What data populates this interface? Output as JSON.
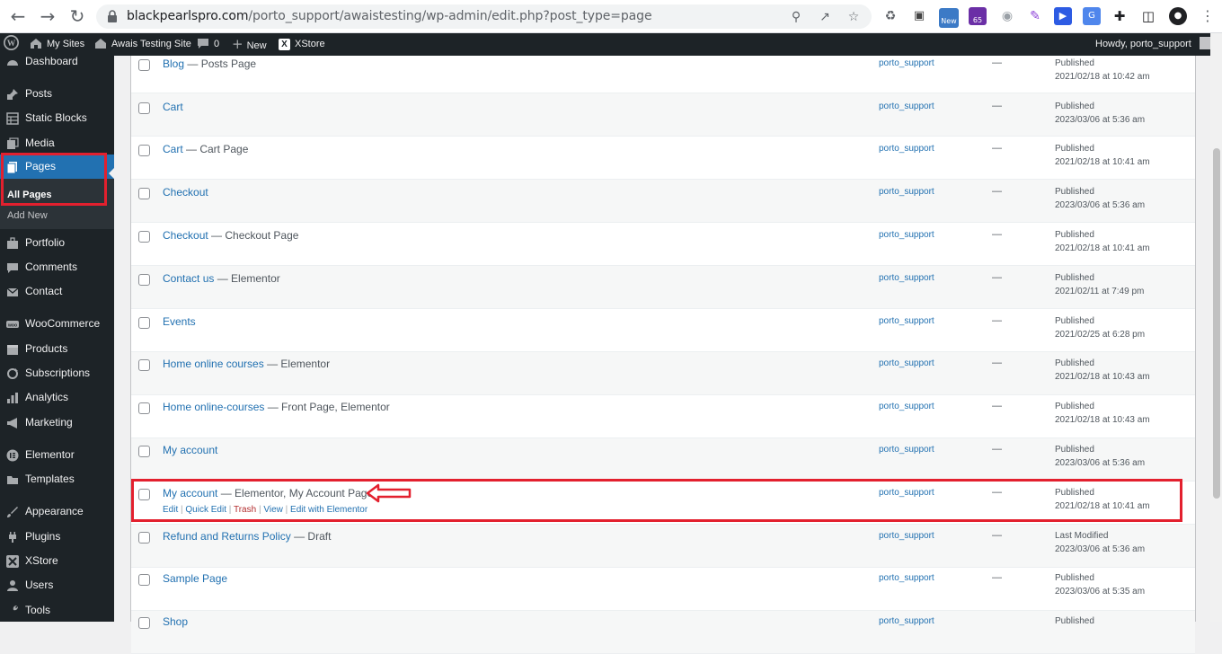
{
  "browser": {
    "url_host": "blackpearlspro.com",
    "url_path": "/porto_support/awaistesting/wp-admin/edit.php?post_type=page",
    "ext_badge_new": "New",
    "ext_badge_count": "65"
  },
  "adminbar": {
    "my_sites": "My Sites",
    "site_name": "Awais Testing Site",
    "comments_count": "0",
    "new_label": "New",
    "xstore_label": "XStore",
    "howdy": "Howdy, porto_support"
  },
  "sidebar": {
    "items": [
      {
        "label": "Dashboard"
      },
      {
        "label": "Posts"
      },
      {
        "label": "Static Blocks"
      },
      {
        "label": "Media"
      },
      {
        "label": "Pages"
      },
      {
        "label": "Portfolio"
      },
      {
        "label": "Comments"
      },
      {
        "label": "Contact"
      },
      {
        "label": "WooCommerce"
      },
      {
        "label": "Products"
      },
      {
        "label": "Subscriptions"
      },
      {
        "label": "Analytics"
      },
      {
        "label": "Marketing"
      },
      {
        "label": "Elementor"
      },
      {
        "label": "Templates"
      },
      {
        "label": "Appearance"
      },
      {
        "label": "Plugins"
      },
      {
        "label": "XStore"
      },
      {
        "label": "Users"
      },
      {
        "label": "Tools"
      }
    ],
    "pages_sub": {
      "all_pages": "All Pages",
      "add_new": "Add New"
    }
  },
  "rows": [
    {
      "title": "Blog",
      "suffix": " — Posts Page",
      "author": "porto_support",
      "comments": "—",
      "status": "Published",
      "date": "2021/02/18 at 10:42 am"
    },
    {
      "title": "Cart",
      "suffix": "",
      "author": "porto_support",
      "comments": "—",
      "status": "Published",
      "date": "2023/03/06 at 5:36 am"
    },
    {
      "title": "Cart",
      "suffix": " — Cart Page",
      "author": "porto_support",
      "comments": "—",
      "status": "Published",
      "date": "2021/02/18 at 10:41 am"
    },
    {
      "title": "Checkout",
      "suffix": "",
      "author": "porto_support",
      "comments": "—",
      "status": "Published",
      "date": "2023/03/06 at 5:36 am"
    },
    {
      "title": "Checkout",
      "suffix": " — Checkout Page",
      "author": "porto_support",
      "comments": "—",
      "status": "Published",
      "date": "2021/02/18 at 10:41 am"
    },
    {
      "title": "Contact us",
      "suffix": " — Elementor",
      "author": "porto_support",
      "comments": "—",
      "status": "Published",
      "date": "2021/02/11 at 7:49 pm"
    },
    {
      "title": "Events",
      "suffix": "",
      "author": "porto_support",
      "comments": "—",
      "status": "Published",
      "date": "2021/02/25 at 6:28 pm"
    },
    {
      "title": "Home online courses",
      "suffix": " — Elementor",
      "author": "porto_support",
      "comments": "—",
      "status": "Published",
      "date": "2021/02/18 at 10:43 am"
    },
    {
      "title": "Home online-courses",
      "suffix": " — Front Page, Elementor",
      "author": "porto_support",
      "comments": "—",
      "status": "Published",
      "date": "2021/02/18 at 10:43 am"
    },
    {
      "title": "My account",
      "suffix": "",
      "author": "porto_support",
      "comments": "—",
      "status": "Published",
      "date": "2023/03/06 at 5:36 am"
    },
    {
      "title": "My account",
      "suffix": " — Elementor, My Account Page",
      "author": "porto_support",
      "comments": "—",
      "status": "Published",
      "date": "2021/02/18 at 10:41 am"
    },
    {
      "title": "Refund and Returns Policy",
      "suffix": " — Draft",
      "author": "porto_support",
      "comments": "—",
      "status": "Last Modified",
      "date": "2023/03/06 at 5:36 am"
    },
    {
      "title": "Sample Page",
      "suffix": "",
      "author": "porto_support",
      "comments": "—",
      "status": "Published",
      "date": "2023/03/06 at 5:35 am"
    },
    {
      "title": "Shop",
      "suffix": "",
      "author": "porto_support",
      "comments": "",
      "status": "Published",
      "date": ""
    }
  ],
  "row_actions": {
    "edit": "Edit",
    "quick_edit": "Quick Edit",
    "trash": "Trash",
    "view": "View",
    "edit_elementor": "Edit with Elementor"
  },
  "colors": {
    "accent": "#2271b1",
    "admin_dark": "#1d2327",
    "annotation_red": "#e3202e"
  }
}
